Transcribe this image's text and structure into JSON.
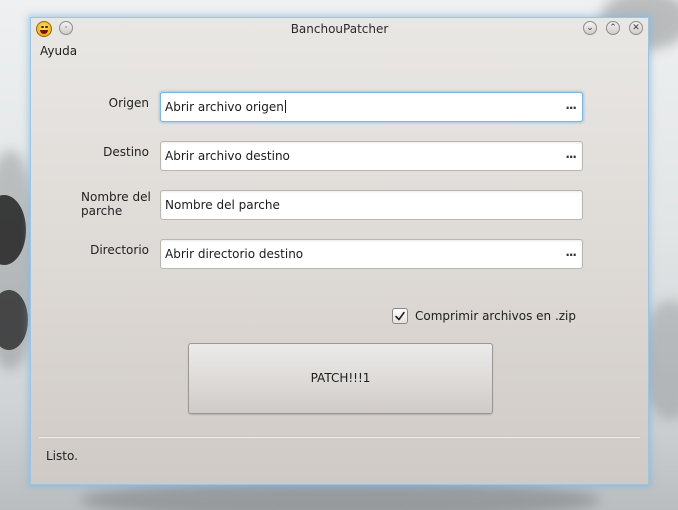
{
  "window": {
    "title": "BanchouPatcher"
  },
  "titlebar": {
    "menu_glyph": "·",
    "minimize_glyph": "⌄",
    "maximize_glyph": "⌃",
    "close_glyph": "✕",
    "app_icon": "smiley-app-icon"
  },
  "menubar": {
    "help_label": "Ayuda"
  },
  "form": {
    "origin": {
      "label": "Origen",
      "value": "Abrir archivo origen",
      "browse": "..."
    },
    "destination": {
      "label": "Destino",
      "value": "Abrir archivo destino",
      "browse": "..."
    },
    "patch_name": {
      "label": "Nombre del parche",
      "value": "Nombre del parche"
    },
    "directory": {
      "label": "Directorio",
      "value": "Abrir directorio destino",
      "browse": "..."
    }
  },
  "compress": {
    "label": "Comprimir archivos en .zip",
    "checked": true
  },
  "patch_button": {
    "label": "PATCH!!!1"
  },
  "status": {
    "text": "Listo."
  },
  "colors": {
    "focus_ring": "#7fb6dd",
    "window_border": "#9fc4df"
  }
}
